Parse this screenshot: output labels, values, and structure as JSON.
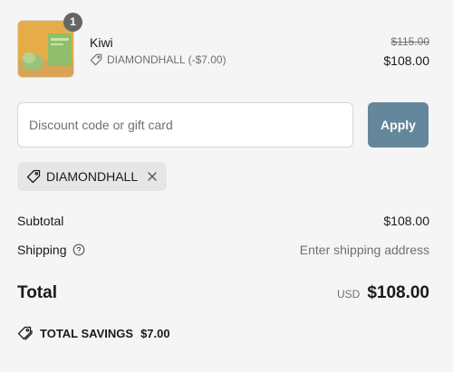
{
  "product": {
    "name": "Kiwi",
    "quantity": "1",
    "discount_code_line": "DIAMONDHALL (-$7.00)",
    "original_price": "$115.00",
    "final_price": "$108.00",
    "image_icon": "product-thumbnail"
  },
  "discount": {
    "placeholder": "Discount code or gift card",
    "value": "",
    "apply_label": "Apply",
    "applied_code": "DIAMONDHALL"
  },
  "summary": {
    "subtotal_label": "Subtotal",
    "subtotal_value": "$108.00",
    "shipping_label": "Shipping",
    "shipping_value": "Enter shipping address",
    "total_label": "Total",
    "currency": "USD",
    "total_value": "$108.00",
    "savings_label": "TOTAL SAVINGS",
    "savings_value": "$7.00"
  },
  "colors": {
    "background": "#f5f5f5",
    "apply_button": "#64879b",
    "chip_background": "#e6e6e6",
    "muted_text": "#707070"
  },
  "icons": {
    "discount_line": "tag-icon",
    "chip": "tag-icon",
    "chip_remove": "close-icon",
    "shipping_help": "question-circle-icon",
    "savings": "tags-icon"
  }
}
